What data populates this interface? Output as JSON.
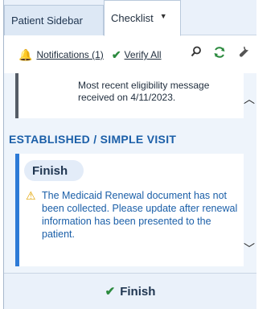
{
  "tabs": [
    {
      "label": "Patient Sidebar"
    },
    {
      "label": "Checklist"
    }
  ],
  "toolbar": {
    "notifications_label": "Notifications (1)",
    "verify_all_label": "Verify All"
  },
  "message": {
    "text": "Most recent eligibility message received on 4/11/2023."
  },
  "section": {
    "title": "ESTABLISHED / SIMPLE VISIT"
  },
  "finish_card": {
    "pill_label": "Finish",
    "warning_text": "The Medicaid Renewal document has not been collected. Please update after renewal information has been presented to the patient."
  },
  "footer": {
    "finish_label": "Finish"
  },
  "colors": {
    "accent": "#2d7ad6",
    "title_blue": "#1b5fa8",
    "check_green": "#2b8a3e",
    "warning": "#e2a400"
  }
}
